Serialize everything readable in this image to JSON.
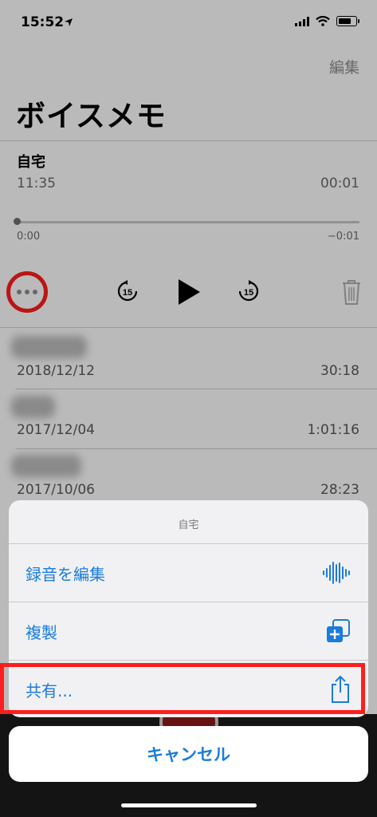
{
  "status_bar": {
    "time": "15:52"
  },
  "header": {
    "edit_label": "編集",
    "title": "ボイスメモ"
  },
  "current_recording": {
    "title": "自宅",
    "time": "11:35",
    "duration": "00:01",
    "position_start": "0:00",
    "position_remaining": "−0:01"
  },
  "recordings": [
    {
      "date": "2018/12/12",
      "duration": "30:18"
    },
    {
      "date": "2017/12/04",
      "duration": "1:01:16"
    },
    {
      "date": "2017/10/06",
      "duration": "28:23"
    }
  ],
  "action_sheet": {
    "title": "自宅",
    "items": [
      {
        "label": "録音を編集",
        "icon": "waveform-icon"
      },
      {
        "label": "複製",
        "icon": "duplicate-icon"
      },
      {
        "label": "共有...",
        "icon": "share-icon"
      }
    ],
    "cancel_label": "キャンセル"
  },
  "colors": {
    "accent": "#1a7cdb",
    "highlight": "#ff1e1e"
  }
}
